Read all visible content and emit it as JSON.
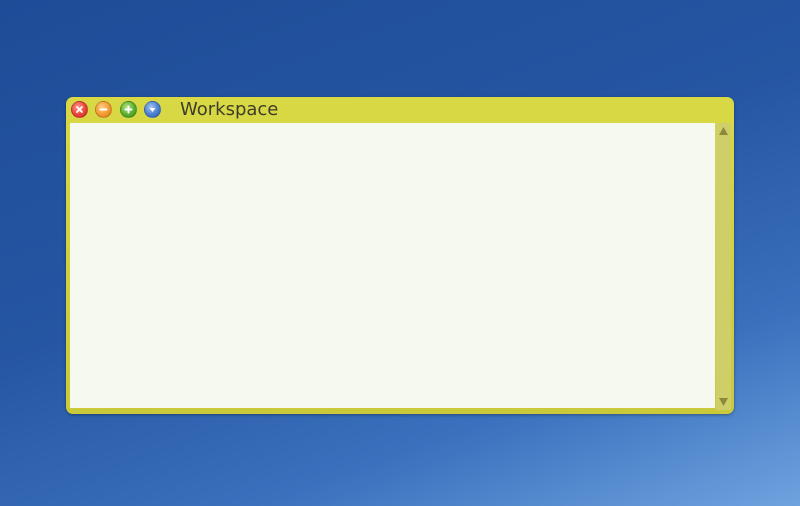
{
  "window": {
    "title": "Workspace",
    "frame_color": "#d4d441",
    "content_color": "#f6f9ef"
  },
  "titlebar_buttons": [
    {
      "icon": "close-icon",
      "color": "#e8453a"
    },
    {
      "icon": "minimize-icon",
      "color": "#f29a2e"
    },
    {
      "icon": "maximize-icon",
      "color": "#5cae2c"
    },
    {
      "icon": "menu-down-icon",
      "color": "#4a7fd0"
    }
  ],
  "scrollbar": {
    "up_icon": "scroll-up-arrow-icon",
    "down_icon": "scroll-down-arrow-icon"
  },
  "desktop": {
    "background_color": "#2556a3"
  }
}
